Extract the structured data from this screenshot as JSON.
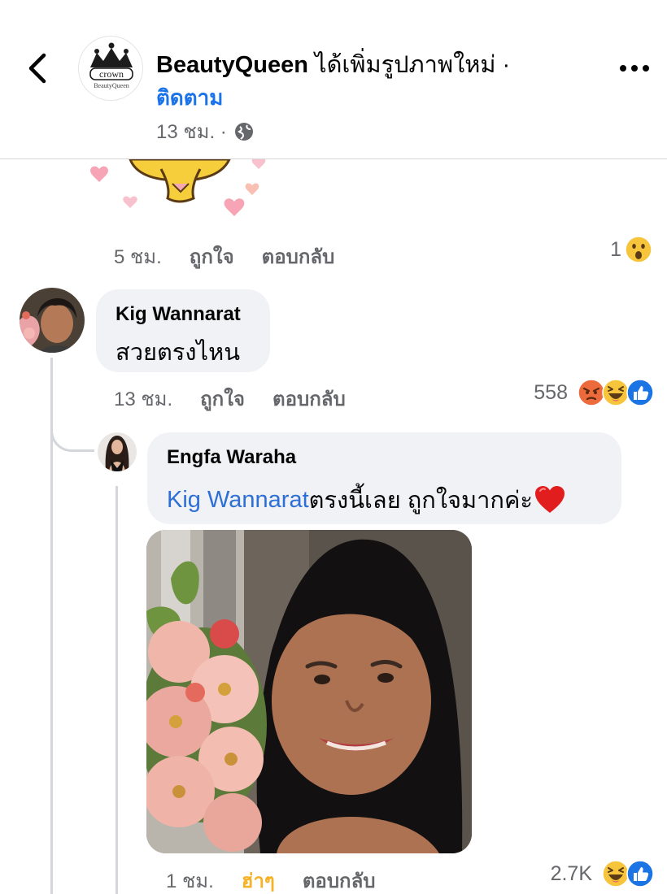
{
  "header": {
    "page_name": "BeautyQueen",
    "action_text": " ได้เพิ่มรูปภาพใหม่ ·",
    "follow_label": "ติดตาม",
    "time": "13 ชม. ·",
    "logo_text_top": "crown",
    "logo_text_bottom": "BeautyQueen"
  },
  "previous_comment": {
    "time": "5 ชม.",
    "like_label": "ถูกใจ",
    "reply_label": "ตอบกลับ",
    "reaction_count": "1",
    "reactions": [
      "wow"
    ]
  },
  "comment": {
    "author": "Kig Wannarat",
    "text": "สวยตรงไหน",
    "time": "13 ชม.",
    "like_label": "ถูกใจ",
    "reply_label": "ตอบกลับ",
    "reaction_count": "558",
    "reactions": [
      "angry",
      "haha",
      "like"
    ]
  },
  "reply": {
    "author": "Engfa Waraha",
    "mention": "Kig Wannarat",
    "text": " ตรงนี้เลย ถูกใจมากค่ะ",
    "emoji": "heart",
    "time": "1 ชม.",
    "reacted_label": "ฮ่าๆ",
    "reply_label": "ตอบกลับ",
    "reaction_count": "2.7K",
    "reactions": [
      "haha",
      "like"
    ]
  },
  "colors": {
    "accent_blue": "#1a73e8",
    "reacted_haha": "#f7b125",
    "bubble_bg": "#f0f2f5",
    "secondary_text": "#65676b"
  }
}
